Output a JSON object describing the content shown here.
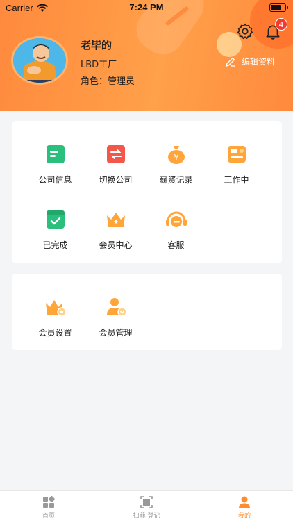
{
  "status_bar": {
    "carrier": "Carrier",
    "time": "7:24 PM"
  },
  "profile": {
    "name": "老毕的",
    "company": "LBD工厂",
    "role": "角色：管理员",
    "edit_label": "编辑资料",
    "notification_count": "4"
  },
  "menu_main": [
    {
      "label": "公司信息",
      "icon": "company-info-icon"
    },
    {
      "label": "切换公司",
      "icon": "switch-company-icon"
    },
    {
      "label": "薪资记录",
      "icon": "salary-record-icon"
    },
    {
      "label": "工作中",
      "icon": "working-icon"
    },
    {
      "label": "已完成",
      "icon": "completed-icon"
    },
    {
      "label": "会员中心",
      "icon": "member-center-icon"
    },
    {
      "label": "客服",
      "icon": "customer-service-icon"
    }
  ],
  "menu_member": [
    {
      "label": "会员设置",
      "icon": "member-settings-icon"
    },
    {
      "label": "会员管理",
      "icon": "member-management-icon"
    }
  ],
  "tabbar": [
    {
      "label": "首页",
      "icon": "home-icon"
    },
    {
      "label": "扫菲 登记",
      "icon": "scan-icon"
    },
    {
      "label": "我的",
      "icon": "profile-icon"
    }
  ],
  "colors": {
    "accent": "#ff8c2e",
    "green": "#2bbf7e",
    "red": "#f2584a",
    "orange": "#ffa53a",
    "badge": "#f23a2e"
  }
}
